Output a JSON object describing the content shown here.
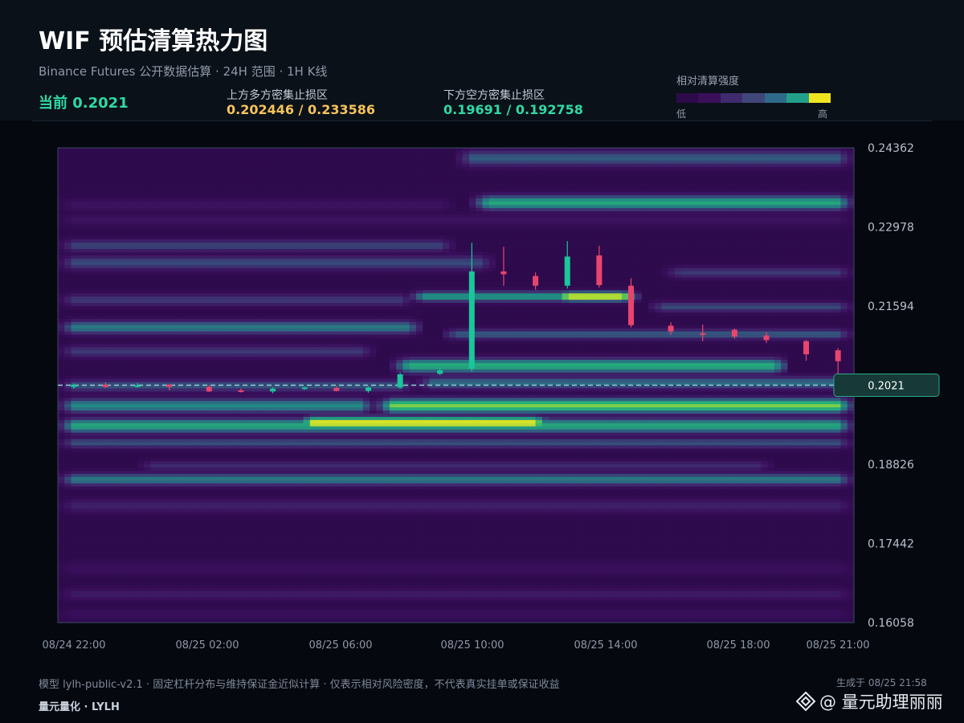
{
  "header": {
    "title": "WIF 预估清算热力图",
    "subtitle": "Binance Futures 公开数据估算 · 24H 范围 · 1H K线",
    "current": "当前 0.2021",
    "upper_label": "上方多方密集止损区",
    "upper_value": "0.202446 / 0.233586",
    "lower_label": "下方空方密集止损区",
    "lower_value": "0.19691 / 0.192758"
  },
  "legend": {
    "title": "相对清算强度",
    "low": "低",
    "high": "高",
    "colors": [
      "#2c0a4a",
      "#3a0f5a",
      "#3f2a6e",
      "#41467a",
      "#2f6a8a",
      "#22a08a",
      "#f0e620"
    ]
  },
  "colors": {
    "up": "#19c79a",
    "down": "#e8456e",
    "current_line": "#8fd0d8",
    "accent_green": "#2fd9a4",
    "accent_yellow": "#f6c35a"
  },
  "chart_data": {
    "type": "heatmap",
    "y_ticks": [
      "0.24362",
      "0.22978",
      "0.21594",
      "0.20210",
      "0.18826",
      "0.17442",
      "0.16058"
    ],
    "y_tick_labels": [
      "0.24362",
      "0.22978",
      "0.21594",
      "",
      "0.18826",
      "0.17442",
      "0.16058"
    ],
    "ylim": [
      0.16058,
      0.24362
    ],
    "x_ticks": [
      "08/24 22:00",
      "08/25 02:00",
      "08/25 06:00",
      "08/25 10:00",
      "08/25 14:00",
      "08/25 18:00",
      "08/25 21:00"
    ],
    "current_price": 0.2021,
    "current_label": "0.2021",
    "heat_bands": [
      {
        "level": 0.2418,
        "width": 0.0016,
        "t_start": 0.5,
        "t_end": 1.0,
        "intensity": 0.45
      },
      {
        "level": 0.234,
        "width": 0.0014,
        "t_start": 0.52,
        "t_end": 1.0,
        "intensity": 0.7
      },
      {
        "level": 0.2336,
        "width": 0.0012,
        "t_start": 0.0,
        "t_end": 0.5,
        "intensity": 0.18
      },
      {
        "level": 0.231,
        "width": 0.0012,
        "t_start": 0.0,
        "t_end": 1.0,
        "intensity": 0.18
      },
      {
        "level": 0.2265,
        "width": 0.0012,
        "t_start": 0.0,
        "t_end": 0.5,
        "intensity": 0.38
      },
      {
        "level": 0.2235,
        "width": 0.0014,
        "t_start": 0.0,
        "t_end": 0.55,
        "intensity": 0.4
      },
      {
        "level": 0.2218,
        "width": 0.0011,
        "t_start": 0.76,
        "t_end": 1.0,
        "intensity": 0.35
      },
      {
        "level": 0.2176,
        "width": 0.001,
        "t_start": 0.44,
        "t_end": 0.73,
        "intensity": 0.65
      },
      {
        "level": 0.2176,
        "width": 0.0009,
        "t_start": 0.62,
        "t_end": 0.73,
        "intensity": 1.0
      },
      {
        "level": 0.217,
        "width": 0.0012,
        "t_start": 0.0,
        "t_end": 0.45,
        "intensity": 0.35
      },
      {
        "level": 0.2158,
        "width": 0.001,
        "t_start": 0.74,
        "t_end": 1.0,
        "intensity": 0.4
      },
      {
        "level": 0.2122,
        "width": 0.0013,
        "t_start": 0.0,
        "t_end": 0.46,
        "intensity": 0.55
      },
      {
        "level": 0.211,
        "width": 0.001,
        "t_start": 0.48,
        "t_end": 1.0,
        "intensity": 0.45
      },
      {
        "level": 0.208,
        "width": 0.0012,
        "t_start": 0.0,
        "t_end": 0.4,
        "intensity": 0.35
      },
      {
        "level": 0.2055,
        "width": 0.0014,
        "t_start": 0.42,
        "t_end": 0.92,
        "intensity": 0.72
      },
      {
        "level": 0.202,
        "width": 0.0012,
        "t_start": 0.0,
        "t_end": 0.45,
        "intensity": 0.42
      },
      {
        "level": 0.2025,
        "width": 0.0012,
        "t_start": 0.45,
        "t_end": 1.0,
        "intensity": 0.5
      },
      {
        "level": 0.1985,
        "width": 0.0014,
        "t_start": 0.0,
        "t_end": 0.4,
        "intensity": 0.6
      },
      {
        "level": 0.1985,
        "width": 0.0014,
        "t_start": 0.4,
        "t_end": 1.0,
        "intensity": 0.85
      },
      {
        "level": 0.1955,
        "width": 0.0012,
        "t_start": 0.3,
        "t_end": 0.62,
        "intensity": 1.0
      },
      {
        "level": 0.195,
        "width": 0.0014,
        "t_start": 0.0,
        "t_end": 1.0,
        "intensity": 0.7
      },
      {
        "level": 0.192,
        "width": 0.001,
        "t_start": 0.0,
        "t_end": 1.0,
        "intensity": 0.42
      },
      {
        "level": 0.188,
        "width": 0.001,
        "t_start": 0.1,
        "t_end": 0.9,
        "intensity": 0.3
      },
      {
        "level": 0.1856,
        "width": 0.0012,
        "t_start": 0.0,
        "t_end": 1.0,
        "intensity": 0.55
      },
      {
        "level": 0.181,
        "width": 0.0014,
        "t_start": 0.0,
        "t_end": 1.0,
        "intensity": 0.25
      },
      {
        "level": 0.17,
        "width": 0.0014,
        "t_start": 0.0,
        "t_end": 1.0,
        "intensity": 0.15
      },
      {
        "level": 0.1655,
        "width": 0.0012,
        "t_start": 0.0,
        "t_end": 1.0,
        "intensity": 0.22
      },
      {
        "level": 0.162,
        "width": 0.0012,
        "t_start": 0.0,
        "t_end": 1.0,
        "intensity": 0.14
      }
    ],
    "candles": [
      {
        "t": 0.02,
        "o": 0.2018,
        "c": 0.2022,
        "h": 0.2024,
        "l": 0.2015
      },
      {
        "t": 0.06,
        "o": 0.2022,
        "c": 0.2018,
        "h": 0.2026,
        "l": 0.2016
      },
      {
        "t": 0.1,
        "o": 0.2018,
        "c": 0.2021,
        "h": 0.2025,
        "l": 0.2017
      },
      {
        "t": 0.14,
        "o": 0.2022,
        "c": 0.2018,
        "h": 0.2023,
        "l": 0.2012
      },
      {
        "t": 0.19,
        "o": 0.2018,
        "c": 0.201,
        "h": 0.2021,
        "l": 0.2009
      },
      {
        "t": 0.23,
        "o": 0.2012,
        "c": 0.201,
        "h": 0.2015,
        "l": 0.2008
      },
      {
        "t": 0.27,
        "o": 0.201,
        "c": 0.2015,
        "h": 0.2017,
        "l": 0.2007
      },
      {
        "t": 0.31,
        "o": 0.2015,
        "c": 0.2017,
        "h": 0.2018,
        "l": 0.2013
      },
      {
        "t": 0.35,
        "o": 0.2016,
        "c": 0.2011,
        "h": 0.2019,
        "l": 0.201
      },
      {
        "t": 0.39,
        "o": 0.2011,
        "c": 0.2017,
        "h": 0.2019,
        "l": 0.2008
      },
      {
        "t": 0.43,
        "o": 0.2017,
        "c": 0.204,
        "h": 0.2043,
        "l": 0.2015
      },
      {
        "t": 0.48,
        "o": 0.2041,
        "c": 0.2047,
        "h": 0.205,
        "l": 0.2039
      },
      {
        "t": 0.52,
        "o": 0.205,
        "c": 0.222,
        "h": 0.227,
        "l": 0.2045
      },
      {
        "t": 0.56,
        "o": 0.222,
        "c": 0.2215,
        "h": 0.2263,
        "l": 0.2195
      },
      {
        "t": 0.6,
        "o": 0.2212,
        "c": 0.2195,
        "h": 0.2218,
        "l": 0.2188
      },
      {
        "t": 0.64,
        "o": 0.2195,
        "c": 0.2246,
        "h": 0.2273,
        "l": 0.219
      },
      {
        "t": 0.68,
        "o": 0.2248,
        "c": 0.2196,
        "h": 0.2265,
        "l": 0.2192
      },
      {
        "t": 0.72,
        "o": 0.2195,
        "c": 0.2126,
        "h": 0.2208,
        "l": 0.2122
      },
      {
        "t": 0.77,
        "o": 0.2125,
        "c": 0.2115,
        "h": 0.2131,
        "l": 0.2109
      },
      {
        "t": 0.81,
        "o": 0.2112,
        "c": 0.2111,
        "h": 0.2127,
        "l": 0.2098
      },
      {
        "t": 0.85,
        "o": 0.2118,
        "c": 0.2106,
        "h": 0.212,
        "l": 0.2102
      },
      {
        "t": 0.89,
        "o": 0.2108,
        "c": 0.21,
        "h": 0.2114,
        "l": 0.2095
      },
      {
        "t": 0.94,
        "o": 0.2098,
        "c": 0.2075,
        "h": 0.21,
        "l": 0.2064
      },
      {
        "t": 0.98,
        "o": 0.2082,
        "c": 0.2063,
        "h": 0.2086,
        "l": 0.204
      }
    ]
  },
  "footer": {
    "note": "模型 lylh-public-v2.1 · 固定杠杆分布与维持保证金近似计算 · 仅表示相对风险密度，不代表真实挂单或保证收益",
    "brand": "量元量化 · LYLH",
    "generated": "生成于 08/25 21:58"
  },
  "watermark": {
    "text": "@ 量元助理丽丽"
  }
}
